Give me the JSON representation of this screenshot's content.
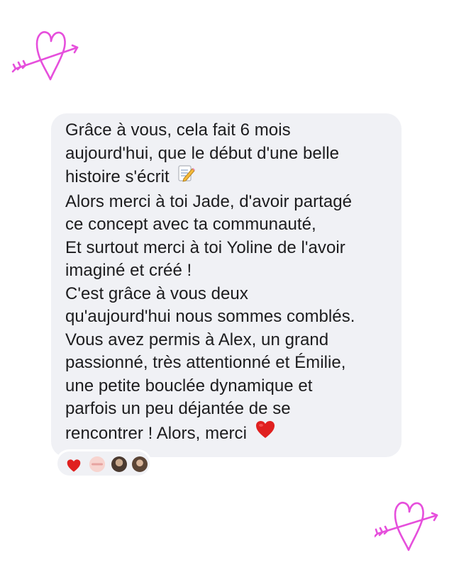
{
  "message": {
    "lines": [
      "Grâce à vous, cela fait 6 mois",
      "aujourd'hui, que le début d'une belle",
      "histoire s'écrit",
      "Alors merci à toi Jade, d'avoir partagé",
      "ce concept avec ta communauté,",
      "Et surtout merci à toi Yoline de l'avoir",
      "imaginé et créé !",
      "C'est grâce à vous deux",
      "qu'aujourd'hui nous sommes comblés.",
      "Vous avez permis à Alex, un grand",
      "passionné, très attentionné et Émilie,",
      "une petite bouclée dynamique et",
      "parfois un peu déjantée de se",
      "rencontrer ! Alors, merci"
    ],
    "inline_emojis": [
      "memo-icon",
      "red-heart-icon"
    ]
  },
  "reactions": [
    "red-heart-icon",
    "badge-avatar",
    "avatar-1",
    "avatar-2"
  ],
  "decorations": [
    "heart-arrow-icon-top-left",
    "heart-arrow-icon-bottom-right"
  ],
  "colors": {
    "bubble": "#f0f1f5",
    "text": "#1c1c1e",
    "heart_pink": "#e64fdc",
    "red_heart": "#e0201f"
  }
}
